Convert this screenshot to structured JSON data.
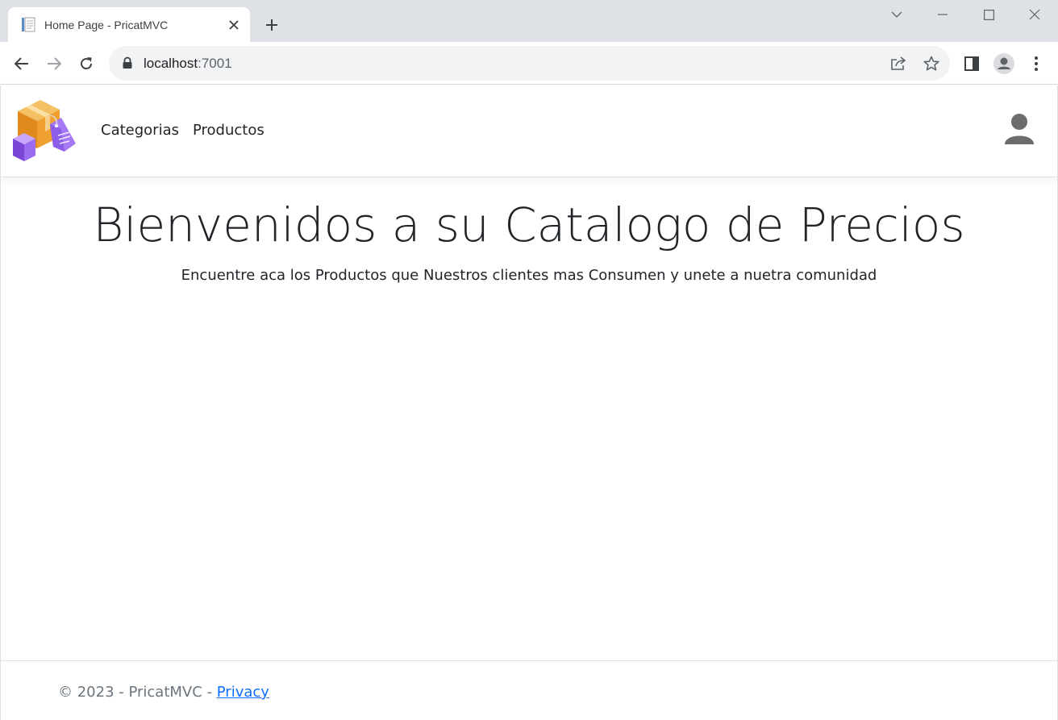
{
  "browser": {
    "tab": {
      "title": "Home Page - PricatMVC",
      "favicon": "page-icon"
    },
    "new_tab_icon": "plus-icon",
    "window_controls": [
      "chevron-down-icon",
      "minimize-icon",
      "maximize-icon",
      "close-icon"
    ],
    "toolbar": {
      "back_icon": "arrow-left-icon",
      "forward_icon": "arrow-right-icon",
      "reload_icon": "reload-icon",
      "url_host": "localhost",
      "url_port": ":7001",
      "share_icon": "share-icon",
      "bookmark_icon": "star-icon",
      "side_panel_icon": "side-panel-icon",
      "profile_icon": "profile-icon",
      "menu_icon": "kebab-menu-icon"
    }
  },
  "navbar": {
    "logo": "boxes-logo",
    "links": [
      {
        "label": "Categorias"
      },
      {
        "label": "Productos"
      }
    ],
    "user_icon": "user-icon"
  },
  "main": {
    "title": "Bienvenidos a su Catalogo de Precios",
    "lead": "Encuentre aca los Productos que Nuestros clientes mas Consumen y unete a nuetra comunidad"
  },
  "footer": {
    "copyright": "© 2023 - PricatMVC - ",
    "privacy_link": "Privacy"
  },
  "colors": {
    "tabstrip": "#dee1e6",
    "omnibox": "#f1f3f4",
    "text": "#212529",
    "muted": "#6c757d",
    "link": "#0d6efd",
    "logo_orange": "#f0a030",
    "logo_purple": "#9b6cf0"
  }
}
